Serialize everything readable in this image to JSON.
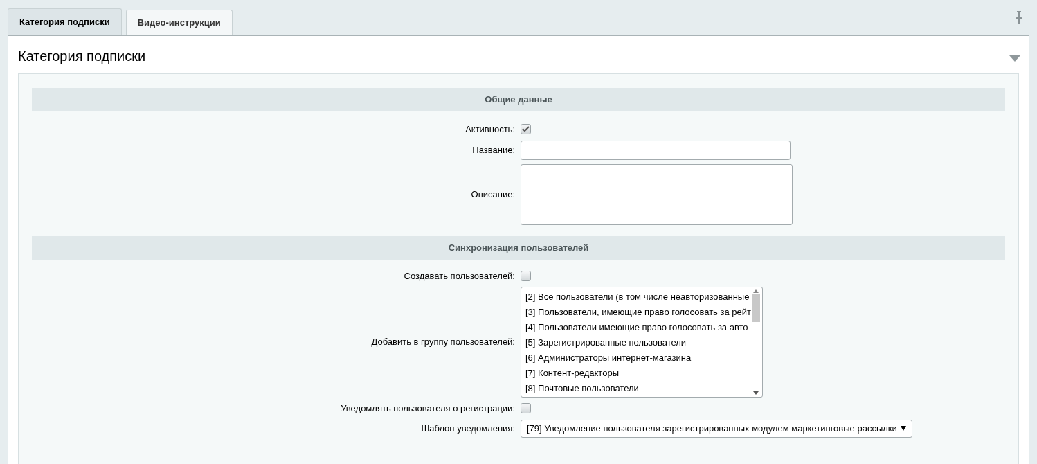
{
  "tabs": [
    {
      "label": "Категория подписки",
      "selected": true
    },
    {
      "label": "Видео-инструкции",
      "selected": false
    }
  ],
  "panel": {
    "title": "Категория подписки",
    "expanded": true
  },
  "sections": [
    {
      "title": "Общие данные",
      "fields": [
        {
          "kind": "checkbox",
          "label": "Активность:",
          "checked": true
        },
        {
          "kind": "text",
          "label": "Название:"
        },
        {
          "kind": "textarea",
          "label": "Описание:"
        }
      ]
    },
    {
      "title": "Синхронизация пользователей",
      "fields": [
        {
          "kind": "checkbox",
          "label": "Создавать пользователей:",
          "checked": false
        },
        {
          "kind": "listbox",
          "label": "Добавить в группу пользователей:",
          "options": [
            {
              "text": "[2] Все пользователи (в том числе неавторизованные",
              "selected": false
            },
            {
              "text": "[3] Пользователи, имеющие право голосовать за рейт",
              "selected": false
            },
            {
              "text": "[4] Пользователи имеющие право голосовать за авто",
              "selected": false
            },
            {
              "text": "[5] Зарегистрированные пользователи",
              "selected": false
            },
            {
              "text": "[6] Администраторы интернет-магазина",
              "selected": false
            },
            {
              "text": "[7] Контент-редакторы",
              "selected": false
            },
            {
              "text": "[8] Почтовые пользователи",
              "selected": false
            }
          ]
        },
        {
          "kind": "checkbox",
          "label": "Уведомлять пользователя о регистрации:",
          "checked": false
        },
        {
          "kind": "select",
          "label": "Шаблон уведомления:",
          "value": "[79] Уведомление пользователя зарегистрированных модулем маркетинговые рассылки"
        }
      ]
    }
  ]
}
